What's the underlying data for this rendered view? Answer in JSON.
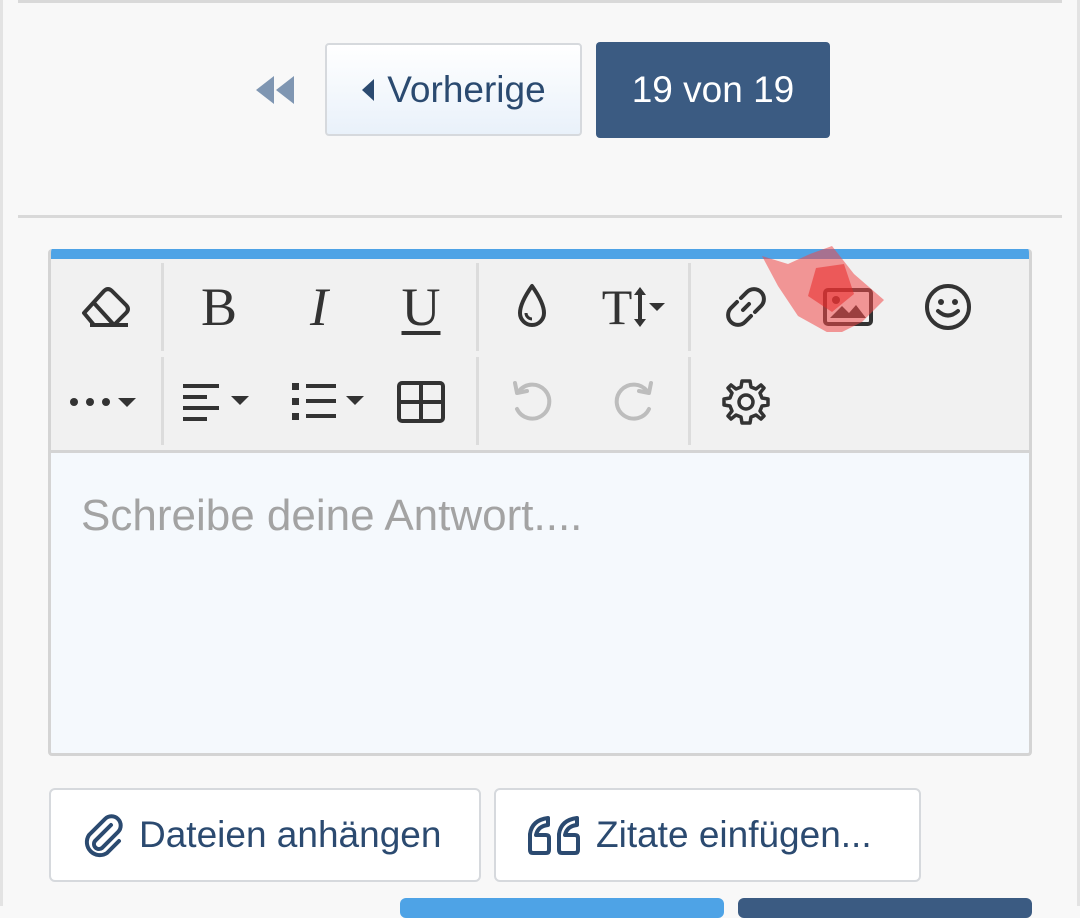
{
  "pagination": {
    "prev_label": "Vorherige",
    "page_indicator": "19 von 19"
  },
  "editor": {
    "placeholder": "Schreibe deine Antwort....",
    "toolbar": {
      "bold_glyph": "B",
      "italic_glyph": "I",
      "underline_glyph": "U",
      "text_size_glyph": "T"
    }
  },
  "actions": {
    "attach_label": "Dateien anhängen",
    "quote_label": "Zitate einfügen..."
  },
  "colors": {
    "primary": "#3b5b82",
    "accent": "#4ea3e6",
    "annotation": "#f04848"
  },
  "icons": [
    "first-page-icon",
    "caret-left-icon",
    "eraser-icon",
    "droplet-icon",
    "link-icon",
    "image-icon",
    "smiley-icon",
    "more-icon",
    "align-icon",
    "list-icon",
    "table-icon",
    "undo-icon",
    "redo-icon",
    "gear-icon",
    "paperclip-icon",
    "quote-icon"
  ]
}
